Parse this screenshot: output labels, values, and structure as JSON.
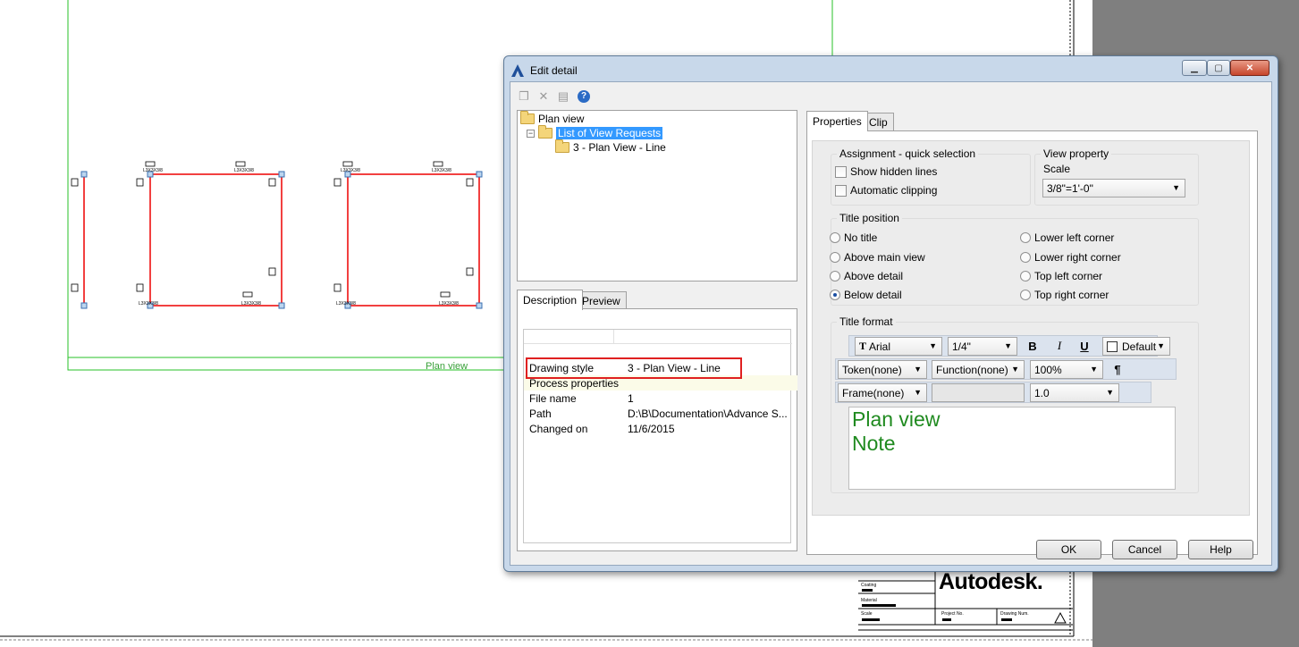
{
  "background": {
    "view_label": "Plan view",
    "brand": "Autodesk.",
    "titleblock_labels": [
      "Coating",
      "Material",
      "Scale",
      "Project No.",
      "Drawing Num."
    ]
  },
  "dialog": {
    "title": "Edit detail",
    "window_buttons": [
      "minimize",
      "maximize",
      "close"
    ],
    "toolbar_icons": [
      "copy-icon",
      "delete-icon",
      "save-icon",
      "help-icon"
    ],
    "tree": {
      "root": "Plan view",
      "child": "List of View Requests",
      "grandchild": "3 - Plan View - Line"
    },
    "left_tabs": [
      "Description",
      "Preview"
    ],
    "properties": [
      {
        "key": "Drawing style",
        "value": "3 - Plan View - Line"
      },
      {
        "key": "Process properties",
        "value": ""
      },
      {
        "key": "File name",
        "value": "1"
      },
      {
        "key": "Path",
        "value": "D:\\B\\Documentation\\Advance S..."
      },
      {
        "key": "Changed on",
        "value": "11/6/2015"
      }
    ],
    "right_tabs": [
      "Properties",
      "Clip"
    ],
    "assignment": {
      "title": "Assignment - quick selection",
      "show_hidden_lines": "Show hidden lines",
      "automatic_clipping": "Automatic clipping"
    },
    "view_property": {
      "title": "View property",
      "scale_label": "Scale",
      "scale_value": "3/8\"=1'-0\""
    },
    "title_position": {
      "title": "Title position",
      "options_left": [
        "No title",
        "Above main view",
        "Above detail",
        "Below detail"
      ],
      "options_right": [
        "Lower left corner",
        "Lower right corner",
        "Top left corner",
        "Top right corner"
      ],
      "selected": "Below detail"
    },
    "title_format": {
      "title": "Title format",
      "font": "Arial",
      "size": "1/4\"",
      "bold": "B",
      "italic": "I",
      "underline": "U",
      "color": "Default",
      "token": "Token(none)",
      "function": "Function(none)",
      "percent": "100%",
      "para": "¶",
      "frame": "Frame(none)",
      "ratio": "1.0",
      "text_line1": "Plan view",
      "text_line2": "Note",
      "text_color": "#1f8a1f"
    },
    "buttons": {
      "ok": "OK",
      "cancel": "Cancel",
      "help": "Help"
    }
  }
}
